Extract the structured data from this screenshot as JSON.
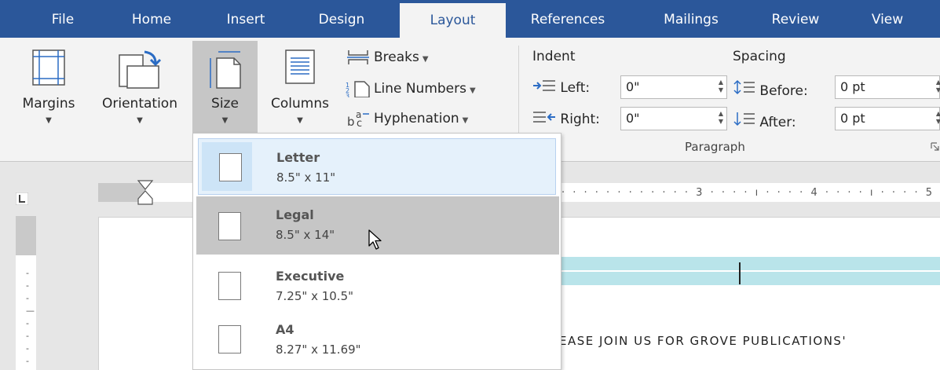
{
  "tabs": [
    {
      "label": "File"
    },
    {
      "label": "Home"
    },
    {
      "label": "Insert"
    },
    {
      "label": "Design"
    },
    {
      "label": "Layout"
    },
    {
      "label": "References"
    },
    {
      "label": "Mailings"
    },
    {
      "label": "Review"
    },
    {
      "label": "View"
    }
  ],
  "active_tab": "Layout",
  "page_setup": {
    "margins_label": "Margins",
    "orientation_label": "Orientation",
    "size_label": "Size",
    "columns_label": "Columns",
    "breaks_label": "Breaks",
    "line_numbers_label": "Line Numbers",
    "hyphenation_label": "Hyphenation"
  },
  "paragraph": {
    "group_label": "Paragraph",
    "indent_label": "Indent",
    "spacing_label": "Spacing",
    "left_label": "Left:",
    "right_label": "Right:",
    "before_label": "Before:",
    "after_label": "After:",
    "left_value": "0\"",
    "right_value": "0\"",
    "before_value": "0 pt",
    "after_value": "0 pt"
  },
  "ruler": {
    "ticks": "· · · · · · · · · · · · 3 · · · · ı · · · · 4 · · · · ı · · · · 5 · ·"
  },
  "document": {
    "visible_text": "EASE JOIN US FOR GROVE PUBLICATIONS'"
  },
  "size_menu": {
    "items": [
      {
        "name": "Letter",
        "dims": "8.5\" x 11\"",
        "state": "selected"
      },
      {
        "name": "Legal",
        "dims": "8.5\" x 14\"",
        "state": "hover"
      },
      {
        "name": "Executive",
        "dims": "7.25\" x 10.5\"",
        "state": "normal"
      },
      {
        "name": "A4",
        "dims": "8.27\" x 11.69\"",
        "state": "normal"
      }
    ]
  },
  "colors": {
    "tabbar": "#2b579a",
    "ribbon": "#f3f3f3",
    "pressed": "#c6c6c6",
    "selected_item": "#e5f1fb",
    "text_highlight": "#b9e4ea"
  }
}
